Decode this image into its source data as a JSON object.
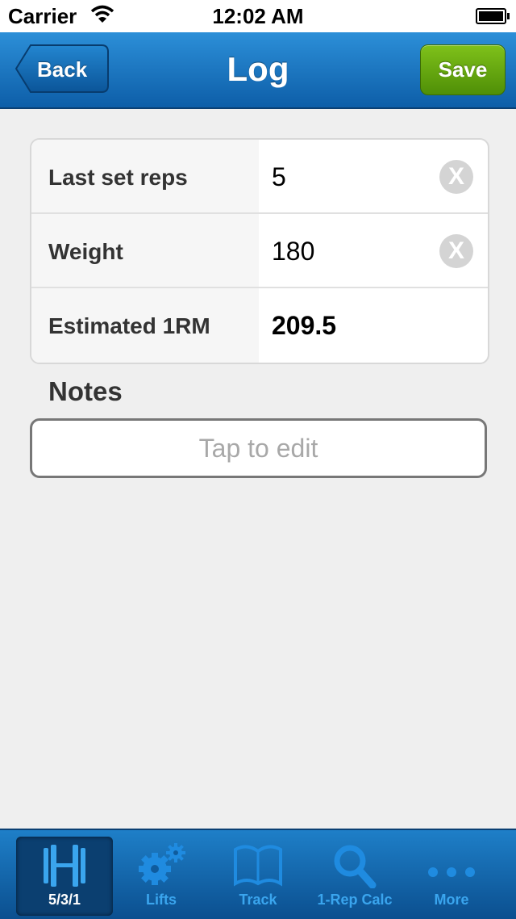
{
  "status_bar": {
    "carrier": "Carrier",
    "time": "12:02 AM"
  },
  "nav": {
    "back_label": "Back",
    "title": "Log",
    "save_label": "Save"
  },
  "form": {
    "rows": [
      {
        "label": "Last set reps",
        "value": "5"
      },
      {
        "label": "Weight",
        "value": "180"
      },
      {
        "label": "Estimated 1RM",
        "value": "209.5"
      }
    ],
    "clear_glyph": "X"
  },
  "notes": {
    "title": "Notes",
    "placeholder": "Tap to edit"
  },
  "tabs": [
    {
      "label": "5/3/1",
      "icon": "barbell-icon",
      "selected": true
    },
    {
      "label": "Lifts",
      "icon": "gears-icon",
      "selected": false
    },
    {
      "label": "Track",
      "icon": "book-icon",
      "selected": false
    },
    {
      "label": "1-Rep Calc",
      "icon": "magnifier-icon",
      "selected": false
    },
    {
      "label": "More",
      "icon": "more-dots-icon",
      "selected": false
    }
  ],
  "colors": {
    "nav_blue": "#1a78c6",
    "save_green": "#6aae12",
    "tab_icon": "#3aa5ee"
  }
}
